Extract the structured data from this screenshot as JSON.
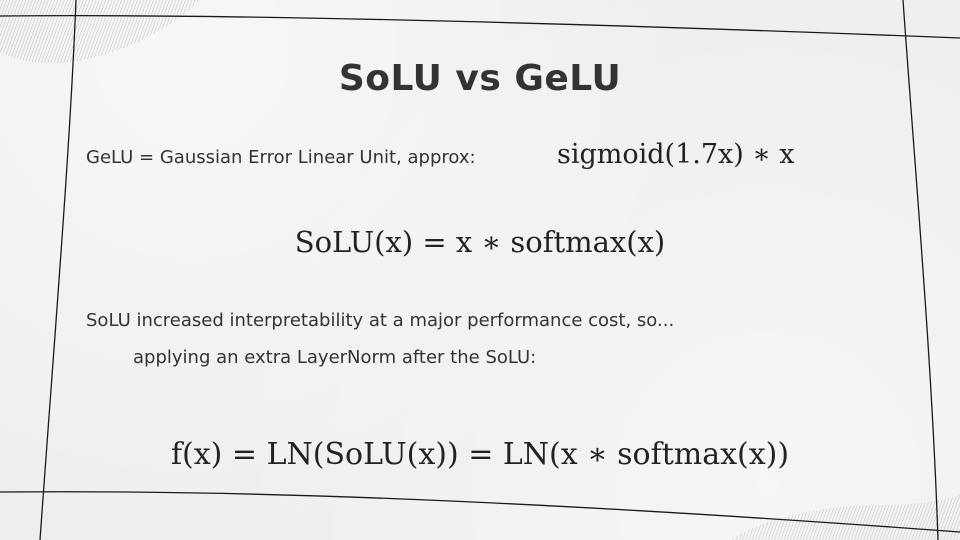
{
  "slide": {
    "title": "SoLU vs GeLU",
    "gelu_text": "GeLU = Gaussian Error Linear Unit, approx:",
    "gelu_formula": "sigmoid(1.7x) ∗ x",
    "solu_formula": "SoLU(x) = x ∗ softmax(x)",
    "note_line1": "SoLU increased interpretability at a major performance cost, so...",
    "note_line2": "applying an extra LayerNorm after the SoLU:",
    "final_formula": "f(x) = LN(SoLU(x)) = LN(x ∗ softmax(x))"
  }
}
